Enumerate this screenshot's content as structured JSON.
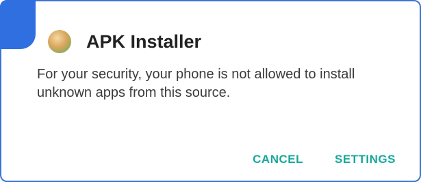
{
  "dialog": {
    "title": "APK Installer",
    "icon": "apk-installer-icon",
    "message": "For your security, your phone is not allowed to install unknown apps from this source.",
    "buttons": {
      "cancel": "CANCEL",
      "settings": "SETTINGS"
    }
  },
  "colors": {
    "accent": "#17a89a",
    "frame": "#3b74d4",
    "corner": "#2f6fe0"
  }
}
